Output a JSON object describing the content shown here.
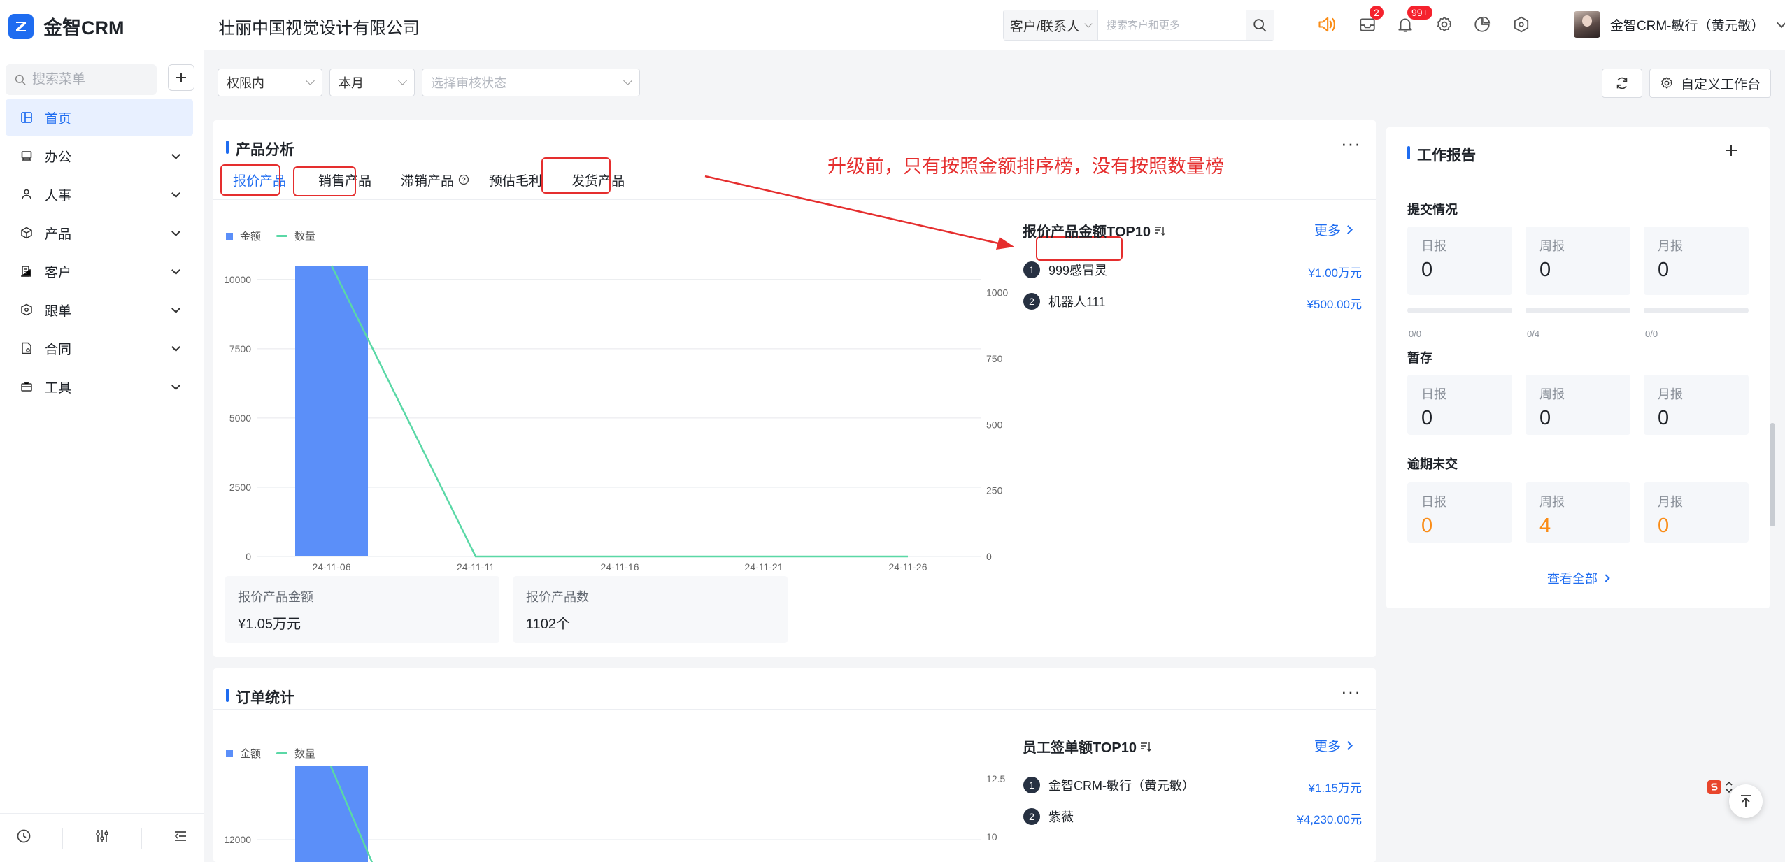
{
  "header": {
    "app_name": "金智CRM",
    "company": "壮丽中国视觉设计有限公司",
    "search_type": "客户/联系人",
    "search_placeholder": "搜索客户和更多",
    "badge_messages": "2",
    "badge_notifications": "99+",
    "user_name": "金智CRM-敏行（黄元敏）"
  },
  "sidebar": {
    "search_placeholder": "搜索菜单",
    "items": [
      {
        "label": "首页",
        "icon": "home-grid-icon"
      },
      {
        "label": "办公",
        "icon": "desk-icon"
      },
      {
        "label": "人事",
        "icon": "people-icon"
      },
      {
        "label": "产品",
        "icon": "cube-icon"
      },
      {
        "label": "客户",
        "icon": "building-icon"
      },
      {
        "label": "跟单",
        "icon": "shield-icon"
      },
      {
        "label": "合同",
        "icon": "contract-icon"
      },
      {
        "label": "工具",
        "icon": "toolbox-icon"
      }
    ]
  },
  "filters": {
    "scope": "权限内",
    "period": "本月",
    "audit_placeholder": "选择审核状态",
    "customize_label": "自定义工作台"
  },
  "product_analysis": {
    "title": "产品分析",
    "tabs": [
      "报价产品",
      "销售产品",
      "滞销产品",
      "预估毛利",
      "发货产品"
    ],
    "annotation": "升级前，只有按照金额排序榜，没有按照数量榜",
    "legend": [
      "金额",
      "数量"
    ],
    "stat_amount_label": "报价产品金额",
    "stat_amount_value": "¥1.05万元",
    "stat_count_label": "报价产品数",
    "stat_count_value": "1102个",
    "rank_title": "报价产品金额TOP10",
    "rank_more": "更多",
    "rank_items": [
      {
        "no": "1",
        "name": "999感冒灵",
        "amount": "¥1.00万元"
      },
      {
        "no": "2",
        "name": "机器人111",
        "amount": "¥500.00元"
      }
    ]
  },
  "order_stats": {
    "title": "订单统计",
    "legend": [
      "金额",
      "数量"
    ],
    "rank_title": "员工签单额TOP10",
    "rank_more": "更多",
    "rank_items": [
      {
        "no": "1",
        "name": "金智CRM-敏行（黄元敏）",
        "amount": "¥1.15万元"
      },
      {
        "no": "2",
        "name": "紫薇",
        "amount": "¥4,230.00元"
      }
    ]
  },
  "work_report": {
    "title": "工作报告",
    "submit_title": "提交情况",
    "draft_title": "暂存",
    "overdue_title": "逾期未交",
    "labels": [
      "日报",
      "周报",
      "月报"
    ],
    "submit_values": [
      "0",
      "0",
      "0"
    ],
    "submit_fracs": [
      "0/0",
      "0/4",
      "0/0"
    ],
    "submit_progress": [
      0,
      0,
      0
    ],
    "draft_values": [
      "0",
      "0",
      "0"
    ],
    "overdue_values": [
      "0",
      "4",
      "0"
    ],
    "view_all": "查看全部"
  },
  "chart_data": [
    {
      "type": "bar",
      "x": [
        "24-11-06",
        "24-11-11",
        "24-11-16",
        "24-11-21",
        "24-11-26"
      ],
      "series": [
        {
          "name": "金额",
          "type": "bar",
          "values": [
            10500,
            0,
            0,
            0,
            0
          ]
        },
        {
          "name": "数量",
          "type": "line",
          "values": [
            1102,
            0,
            0,
            0,
            0
          ]
        }
      ],
      "y_left_ticks": [
        "0",
        "2500",
        "5000",
        "7500",
        "10000"
      ],
      "y_right_ticks": [
        "0",
        "250",
        "500",
        "750",
        "1000"
      ],
      "y_left_range": [
        0,
        10000
      ],
      "y_right_range": [
        0,
        1000
      ],
      "grid": true,
      "legend_position": "top-left"
    },
    {
      "type": "bar",
      "series": [
        {
          "name": "金额",
          "type": "bar"
        },
        {
          "name": "数量",
          "type": "line"
        }
      ],
      "y_left_ticks": [
        "12000"
      ],
      "y_right_ticks": [
        "10",
        "12.5"
      ],
      "grid": true,
      "legend_position": "top-left"
    }
  ]
}
